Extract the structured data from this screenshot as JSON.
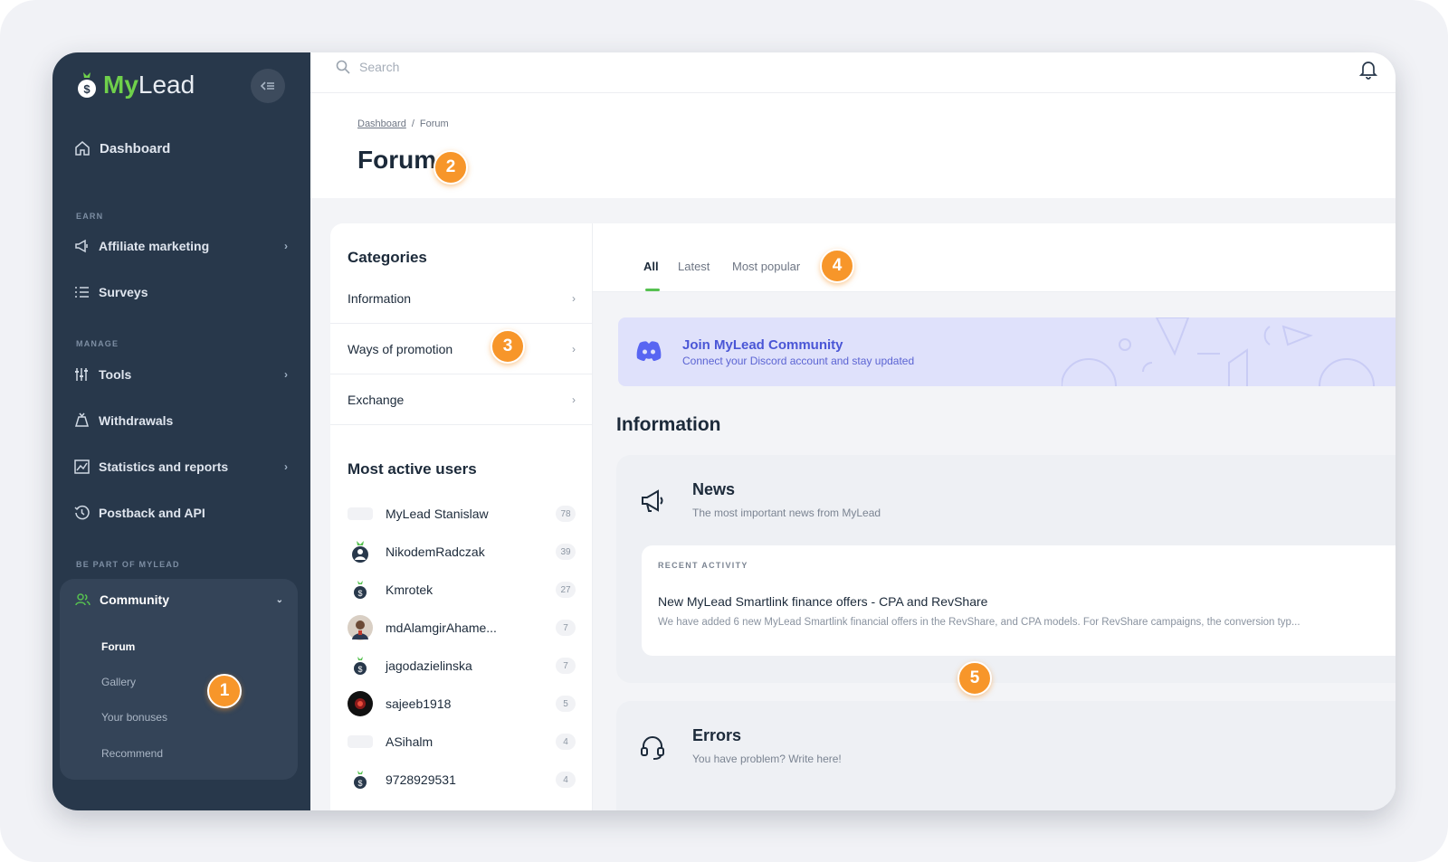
{
  "app": {
    "brand_prefix": "My",
    "brand_suffix": "Lead"
  },
  "sidebar": {
    "dashboard": "Dashboard",
    "sections": {
      "earn": "EARN",
      "manage": "MANAGE",
      "be_part": "BE PART OF MYLEAD"
    },
    "items": {
      "affiliate": "Affiliate marketing",
      "surveys": "Surveys",
      "tools": "Tools",
      "withdrawals": "Withdrawals",
      "statistics": "Statistics and reports",
      "postback": "Postback and API",
      "community": "Community"
    },
    "community_sub": [
      "Forum",
      "Gallery",
      "Your bonuses",
      "Recommend"
    ]
  },
  "topbar": {
    "search_placeholder": "Search"
  },
  "header": {
    "breadcrumb_root": "Dashboard",
    "breadcrumb_sep": "/",
    "breadcrumb_current": "Forum",
    "title": "Forum"
  },
  "badges": [
    "1",
    "2",
    "3",
    "4",
    "5"
  ],
  "categories": {
    "heading": "Categories",
    "items": [
      "Information",
      "Ways of promotion",
      "Exchange"
    ]
  },
  "active_users": {
    "heading": "Most active users",
    "users": [
      {
        "name": "MyLead Stanislaw",
        "count": "78"
      },
      {
        "name": "NikodemRadczak",
        "count": "39"
      },
      {
        "name": "Kmrotek",
        "count": "27"
      },
      {
        "name": "mdAlamgirAhame...",
        "count": "7"
      },
      {
        "name": "jagodazielinska",
        "count": "7"
      },
      {
        "name": "sajeeb1918",
        "count": "5"
      },
      {
        "name": "ASihalm",
        "count": "4"
      },
      {
        "name": "9728929531",
        "count": "4"
      }
    ]
  },
  "tabs": [
    "All",
    "Latest",
    "Most popular"
  ],
  "discord": {
    "title": "Join MyLead Community",
    "subtitle": "Connect your Discord account and stay updated"
  },
  "main": {
    "section_title": "Information",
    "news": {
      "title": "News",
      "subtitle": "The most important news from MyLead",
      "recent_label": "RECENT ACTIVITY",
      "recent_title": "New MyLead Smartlink finance offers - CPA and RevShare",
      "recent_desc": "We have added 6 new MyLead Smartlink financial offers in the RevShare, and CPA models. For RevShare campaigns, the conversion typ..."
    },
    "errors": {
      "title": "Errors",
      "subtitle": "You have problem? Write here!"
    }
  },
  "colors": {
    "sidebar_bg": "#28384b",
    "accent_green": "#56c150",
    "badge_orange": "#f7962a",
    "discord_blue": "#4a56d6"
  }
}
